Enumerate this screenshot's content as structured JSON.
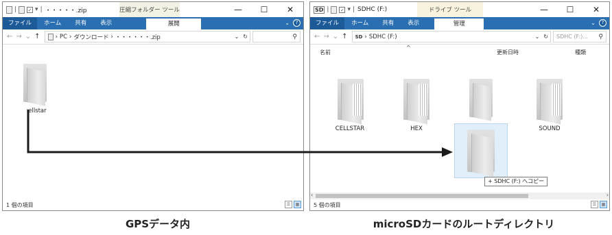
{
  "left_window": {
    "title": "・・・・・.zip",
    "context_tab": "圧縮フォルダー ツール",
    "controls": {
      "minimize": "—",
      "maximize": "☐",
      "close": "✕"
    },
    "ribbon": {
      "file": "ファイル",
      "home": "ホーム",
      "share": "共有",
      "view": "表示",
      "selected": "展開"
    },
    "address": {
      "sep": "›",
      "pc": "PC",
      "downloads": "ダウンロード",
      "zip": "・・・・・・.zip"
    },
    "content": {
      "folder_label": ":ellstar"
    },
    "status": "1 個の項目"
  },
  "right_window": {
    "title": "SDHC (F:)",
    "context_tab": "ドライブ ツール",
    "controls": {
      "minimize": "—",
      "maximize": "☐",
      "close": "✕"
    },
    "ribbon": {
      "file": "ファイル",
      "home": "ホーム",
      "share": "共有",
      "view": "表示",
      "selected": "管理"
    },
    "address": {
      "sep": "›",
      "drive": "SDHC (F:)",
      "search_placeholder": "SDHC (F:)..."
    },
    "columns": {
      "name": "名前",
      "modified": "更新日時",
      "type": "種類"
    },
    "folders": [
      "CELLSTAR",
      "HEX",
      "",
      "SOUND"
    ],
    "drag_tooltip": "+ SDHC (F:) へコピー",
    "status": "5 個の項目"
  },
  "captions": {
    "left": "GPSデータ内",
    "right": "microSDカードのルートディレクトリ"
  },
  "colors": {
    "ribbon_blue": "#2b6fb3",
    "arrow": "#1a1a1a"
  }
}
